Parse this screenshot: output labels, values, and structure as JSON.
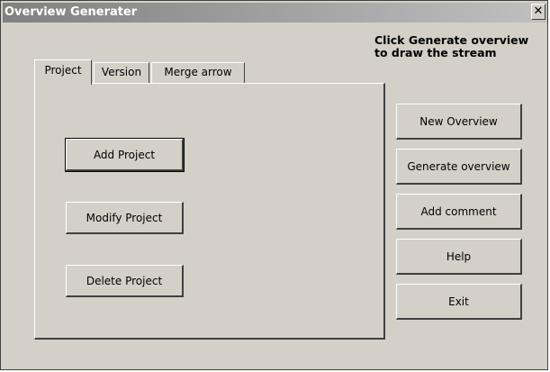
{
  "window": {
    "title": "Overview Generater",
    "close_glyph": "✕"
  },
  "hint": {
    "line1": "Click Generate overview",
    "line2": "to draw the stream"
  },
  "tabs": [
    {
      "label": "Project",
      "active": true
    },
    {
      "label": "Version",
      "active": false
    },
    {
      "label": "Merge arrow",
      "active": false
    }
  ],
  "project_panel": {
    "add_label": "Add Project",
    "modify_label": "Modify Project",
    "delete_label": "Delete Project"
  },
  "side_buttons": {
    "new_overview": "New Overview",
    "generate_overview": "Generate overview",
    "add_comment": "Add comment",
    "help": "Help",
    "exit": "Exit"
  },
  "colors": {
    "face": "#d4d0c8",
    "title_gradient_start": "#808080",
    "title_gradient_end": "#c0c0c0",
    "title_text": "#ffffff"
  }
}
